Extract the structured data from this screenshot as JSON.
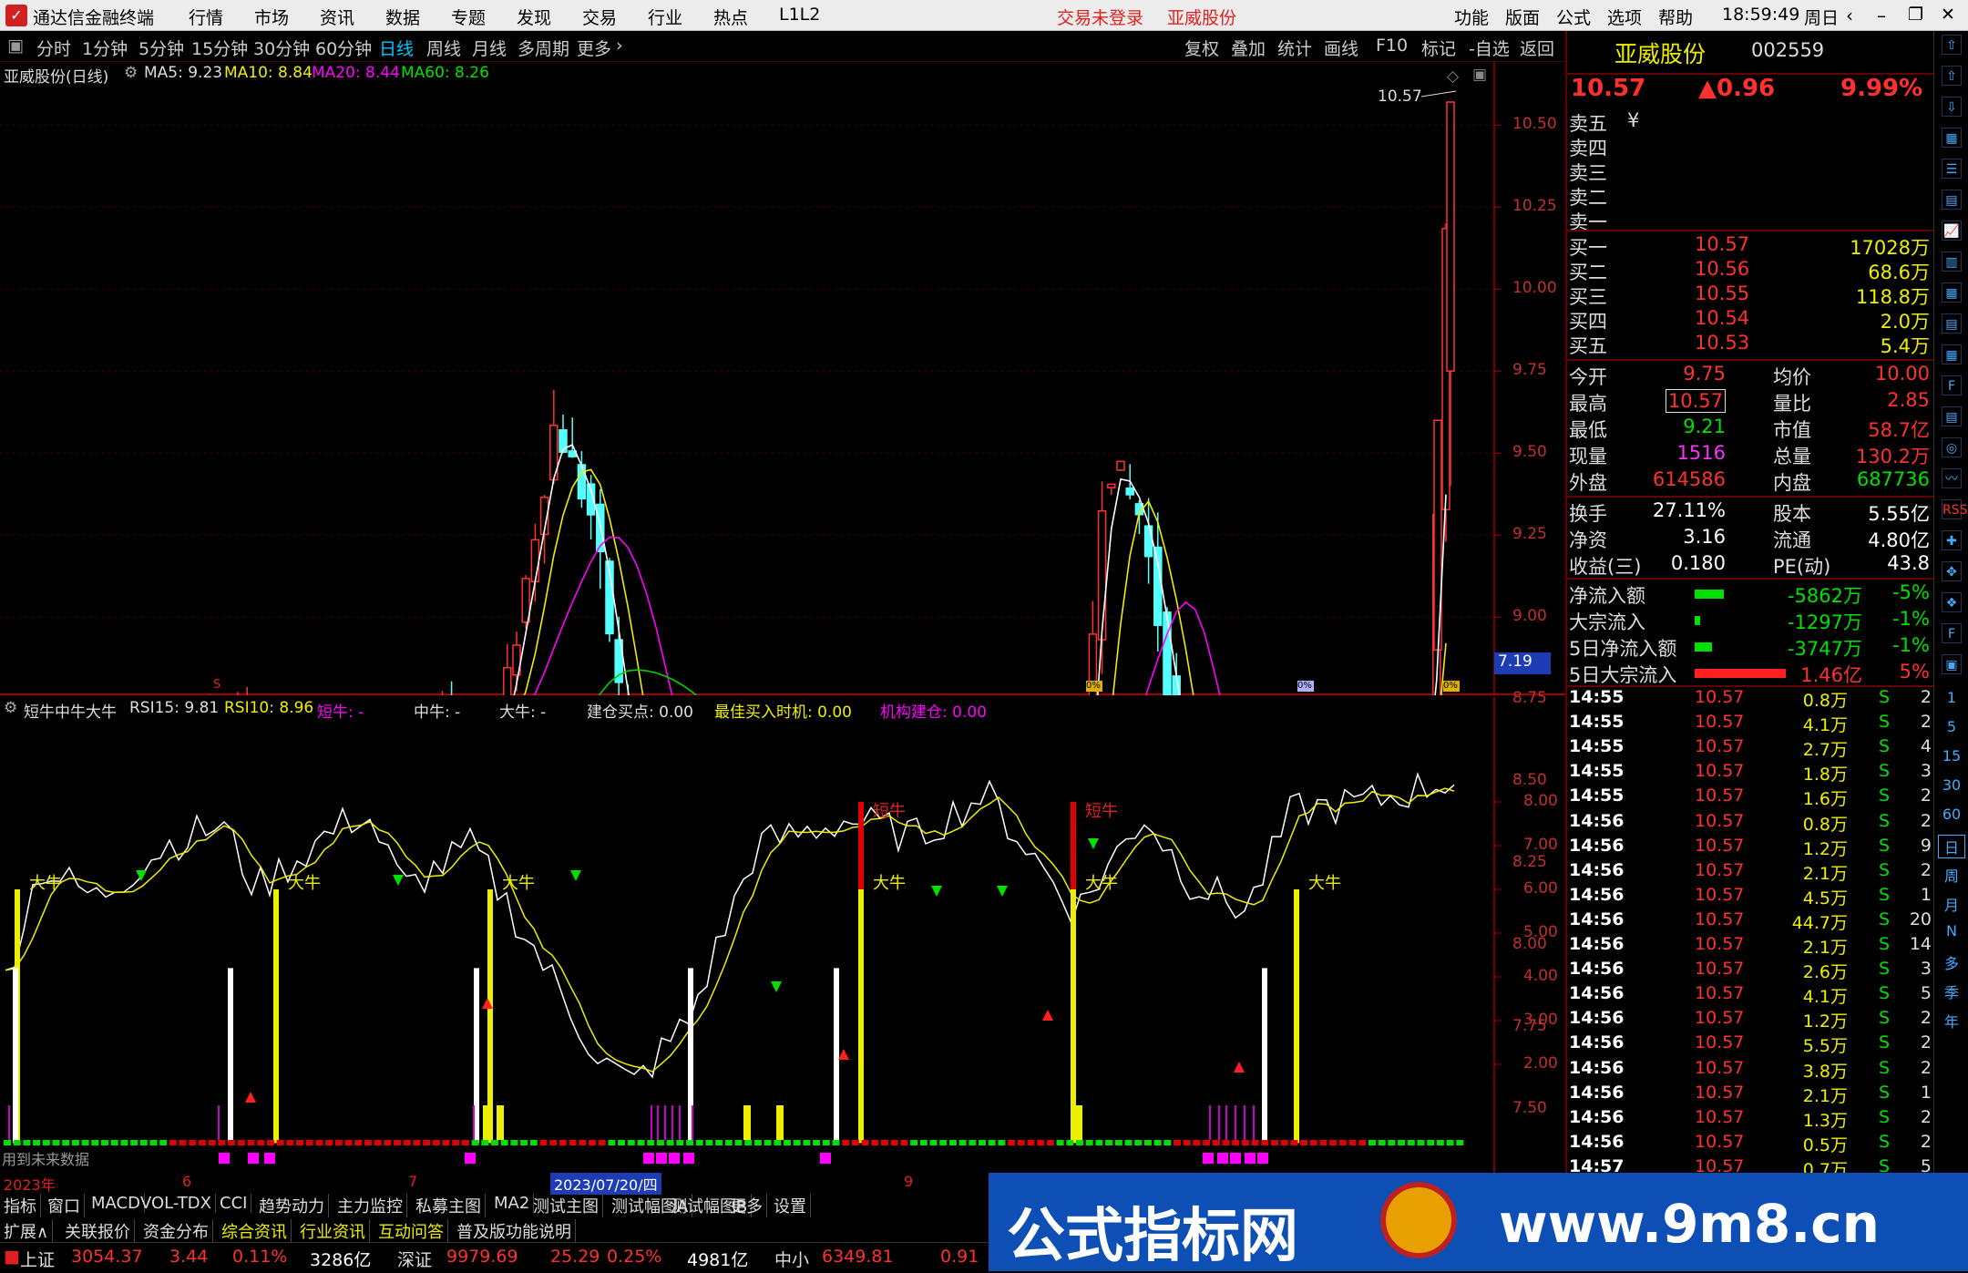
{
  "app": {
    "title": "通达信金融终端",
    "menu": [
      "行情",
      "市场",
      "资讯",
      "数据",
      "专题",
      "发现",
      "交易",
      "行业",
      "热点",
      "L1L2"
    ],
    "login": "交易未登录",
    "stock_name": "亚威股份",
    "right_menu": [
      "功能",
      "版面",
      "公式",
      "选项",
      "帮助"
    ],
    "time": "18:59:49",
    "weekday": "周日"
  },
  "periods": [
    "分时",
    "1分钟",
    "5分钟",
    "15分钟",
    "30分钟",
    "60分钟",
    "日线",
    "周线",
    "月线",
    "多周期",
    "更多"
  ],
  "tools": [
    "复权",
    "叠加",
    "统计",
    "画线",
    "F10",
    "标记",
    "-自选",
    "返回"
  ],
  "main": {
    "title": "亚威股份(日线)",
    "ma5": "MA5: 9.23",
    "ma10": "MA10: 8.84",
    "ma20": "MA20: 8.44",
    "ma60": "MA60: 8.26",
    "high_label": "10.57",
    "yaxis": [
      "10.50",
      "10.25",
      "10.00",
      "9.75",
      "9.50",
      "9.25",
      "9.00",
      "8.75",
      "8.50",
      "8.25",
      "8.00",
      "7.75",
      "7.50"
    ],
    "last_price": "7.19",
    "markers": [
      "S",
      "0%",
      "0%",
      "0%"
    ]
  },
  "sub": {
    "title": "短牛中牛大牛",
    "rsi15": "RSI15: 9.81",
    "rsi10": "RSI10: 8.96",
    "short": "短牛: -",
    "mid": "中牛: -",
    "big": "大牛: -",
    "buy": "建仓买点: 0.00",
    "best": "最佳买入时机: 0.00",
    "inst": "机构建仓: 0.00",
    "yaxis": [
      "8.00",
      "7.00",
      "6.00",
      "5.00",
      "4.00",
      "3.00",
      "2.00"
    ],
    "label_big": "大牛",
    "label_short": "短牛",
    "future": "用到未来数据"
  },
  "dates": [
    "2023年",
    "6",
    "7",
    "2023/07/20/四",
    "9"
  ],
  "bottom_tabs1": [
    "指标",
    "窗口",
    "MACD",
    "VOL-TDX",
    "CCI",
    "趋势动力",
    "主力监控",
    "私募主图",
    "MA2",
    "测试主图",
    "测试幅图A",
    "测试幅图B",
    "更多",
    "设置"
  ],
  "bottom_tabs2": [
    "扩展∧",
    "关联报价",
    "资金分布",
    "综合资讯",
    "行业资讯",
    "互动问答",
    "普及版功能说明"
  ],
  "index": {
    "sh_label": "上证",
    "sh_val": "3054.37",
    "sh_chg": "3.44",
    "sh_pct": "0.11%",
    "sh_amt": "3286亿",
    "sz_label": "深证",
    "sz_val": "9979.69",
    "sz_chg": "25.29",
    "sz_pct": "0.25%",
    "sz_amt": "4981亿",
    "zx_label": "中小",
    "zx_val": "6349.81",
    "zx_chg": "0.91"
  },
  "quote": {
    "name": "亚威股份",
    "code": "002559",
    "price": "10.57",
    "change": "▲0.96",
    "pct": "9.99%",
    "sell": [
      "卖五",
      "卖四",
      "卖三",
      "卖二",
      "卖一"
    ],
    "sell_unit": "¥",
    "buy": [
      {
        "l": "买一",
        "p": "10.57",
        "v": "17028万"
      },
      {
        "l": "买二",
        "p": "10.56",
        "v": "68.6万"
      },
      {
        "l": "买三",
        "p": "10.55",
        "v": "118.8万"
      },
      {
        "l": "买四",
        "p": "10.54",
        "v": "2.0万"
      },
      {
        "l": "买五",
        "p": "10.53",
        "v": "5.4万"
      }
    ],
    "stats": [
      {
        "a": "今开",
        "av": "9.75",
        "b": "均价",
        "bv": "10.00"
      },
      {
        "a": "最高",
        "av": "10.57",
        "b": "量比",
        "bv": "2.85"
      },
      {
        "a": "最低",
        "av": "9.21",
        "b": "市值",
        "bv": "58.7亿"
      },
      {
        "a": "现量",
        "av": "1516",
        "b": "总量",
        "bv": "130.2万"
      },
      {
        "a": "外盘",
        "av": "614586",
        "b": "内盘",
        "bv": "687736"
      }
    ],
    "stats2": [
      {
        "a": "换手",
        "av": "27.11%",
        "b": "股本",
        "bv": "5.55亿"
      },
      {
        "a": "净资",
        "av": "3.16",
        "b": "流通",
        "bv": "4.80亿"
      },
      {
        "a": "收益(三)",
        "av": "0.180",
        "b": "PE(动)",
        "bv": "43.8"
      }
    ],
    "flows": [
      {
        "l": "净流入额",
        "v": "-5862万",
        "p": "-5%",
        "bar": 0.3
      },
      {
        "l": "大宗流入",
        "v": "-1297万",
        "p": "-1%",
        "bar": 0.06
      },
      {
        "l": "5日净流入额",
        "v": "-3747万",
        "p": "-1%",
        "bar": 0.18
      },
      {
        "l": "5日大宗流入",
        "v": "1.46亿",
        "p": "5%",
        "bar": 0.95
      }
    ],
    "ticks": [
      [
        "14:55",
        "10.57",
        "0.8万",
        "2"
      ],
      [
        "14:55",
        "10.57",
        "4.1万",
        "2"
      ],
      [
        "14:55",
        "10.57",
        "2.7万",
        "4"
      ],
      [
        "14:55",
        "10.57",
        "1.8万",
        "3"
      ],
      [
        "14:55",
        "10.57",
        "1.6万",
        "2"
      ],
      [
        "14:56",
        "10.57",
        "0.8万",
        "2"
      ],
      [
        "14:56",
        "10.57",
        "1.2万",
        "9"
      ],
      [
        "14:56",
        "10.57",
        "2.1万",
        "2"
      ],
      [
        "14:56",
        "10.57",
        "4.5万",
        "1"
      ],
      [
        "14:56",
        "10.57",
        "44.7万",
        "20"
      ],
      [
        "14:56",
        "10.57",
        "2.1万",
        "14"
      ],
      [
        "14:56",
        "10.57",
        "2.6万",
        "3"
      ],
      [
        "14:56",
        "10.57",
        "4.1万",
        "5"
      ],
      [
        "14:56",
        "10.57",
        "1.2万",
        "2"
      ],
      [
        "14:56",
        "10.57",
        "5.5万",
        "2"
      ],
      [
        "14:56",
        "10.57",
        "3.8万",
        "2"
      ],
      [
        "14:56",
        "10.57",
        "2.1万",
        "1"
      ],
      [
        "14:56",
        "10.57",
        "1.3万",
        "2"
      ],
      [
        "14:56",
        "10.57",
        "0.5万",
        "2"
      ],
      [
        "14:57",
        "10.57",
        "0.7万",
        "5"
      ]
    ],
    "tick_flag": "S"
  },
  "side_icons": [
    "1",
    "5",
    "15",
    "30",
    "60",
    "日",
    "周",
    "月",
    "N",
    "多",
    "季",
    "年"
  ],
  "watermark": {
    "text": "公式指标网",
    "url": "www.9m8.cn"
  }
}
